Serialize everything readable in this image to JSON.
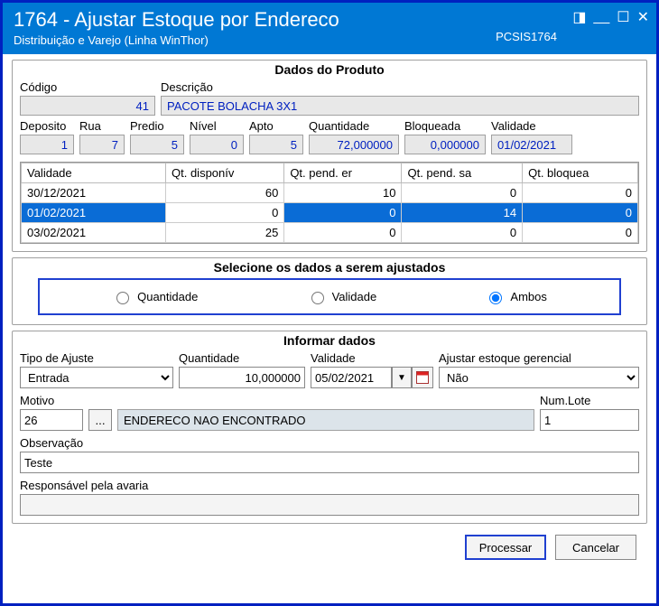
{
  "titlebar": {
    "title": "1764 - Ajustar Estoque por Endereco",
    "subtitle": "Distribuição e Varejo (Linha WinThor)",
    "sysid": "PCSIS1764"
  },
  "produto": {
    "legend": "Dados do Produto",
    "labels": {
      "codigo": "Código",
      "descricao": "Descrição",
      "deposito": "Deposito",
      "rua": "Rua",
      "predio": "Predio",
      "nivel": "Nível",
      "apto": "Apto",
      "quantidade": "Quantidade",
      "bloqueada": "Bloqueada",
      "validade": "Validade"
    },
    "values": {
      "codigo": "41",
      "descricao": "PACOTE BOLACHA 3X1",
      "deposito": "1",
      "rua": "7",
      "predio": "5",
      "nivel": "0",
      "apto": "5",
      "quantidade": "72,000000",
      "bloqueada": "0,000000",
      "validade": "01/02/2021"
    },
    "grid": {
      "headers": [
        "Validade",
        "Qt. disponív",
        "Qt. pend. er",
        "Qt. pend. sa",
        "Qt. bloquea"
      ],
      "rows": [
        {
          "validade": "30/12/2021",
          "disp": "60",
          "pend_e": "10",
          "pend_s": "0",
          "bloq": "0",
          "selected": false
        },
        {
          "validade": "01/02/2021",
          "disp": "0",
          "pend_e": "0",
          "pend_s": "14",
          "bloq": "0",
          "selected": true
        },
        {
          "validade": "03/02/2021",
          "disp": "25",
          "pend_e": "0",
          "pend_s": "0",
          "bloq": "0",
          "selected": false
        }
      ]
    }
  },
  "selecao": {
    "legend": "Selecione os dados a serem ajustados",
    "options": {
      "quantidade": "Quantidade",
      "validade": "Validade",
      "ambos": "Ambos"
    },
    "selected": "ambos"
  },
  "informar": {
    "legend": "Informar dados",
    "labels": {
      "tipo": "Tipo de Ajuste",
      "quantidade": "Quantidade",
      "validade": "Validade",
      "ajustar_ger": "Ajustar estoque gerencial",
      "motivo": "Motivo",
      "num_lote": "Num.Lote",
      "observacao": "Observação",
      "responsavel": "Responsável pela avaria"
    },
    "values": {
      "tipo": "Entrada",
      "quantidade": "10,000000",
      "validade": "05/02/2021",
      "ajustar_ger": "Não",
      "motivo_cod": "26",
      "motivo_desc": "ENDERECO NAO ENCONTRADO",
      "num_lote": "1",
      "observacao": "Teste",
      "responsavel": ""
    }
  },
  "buttons": {
    "processar": "Processar",
    "cancelar": "Cancelar"
  }
}
